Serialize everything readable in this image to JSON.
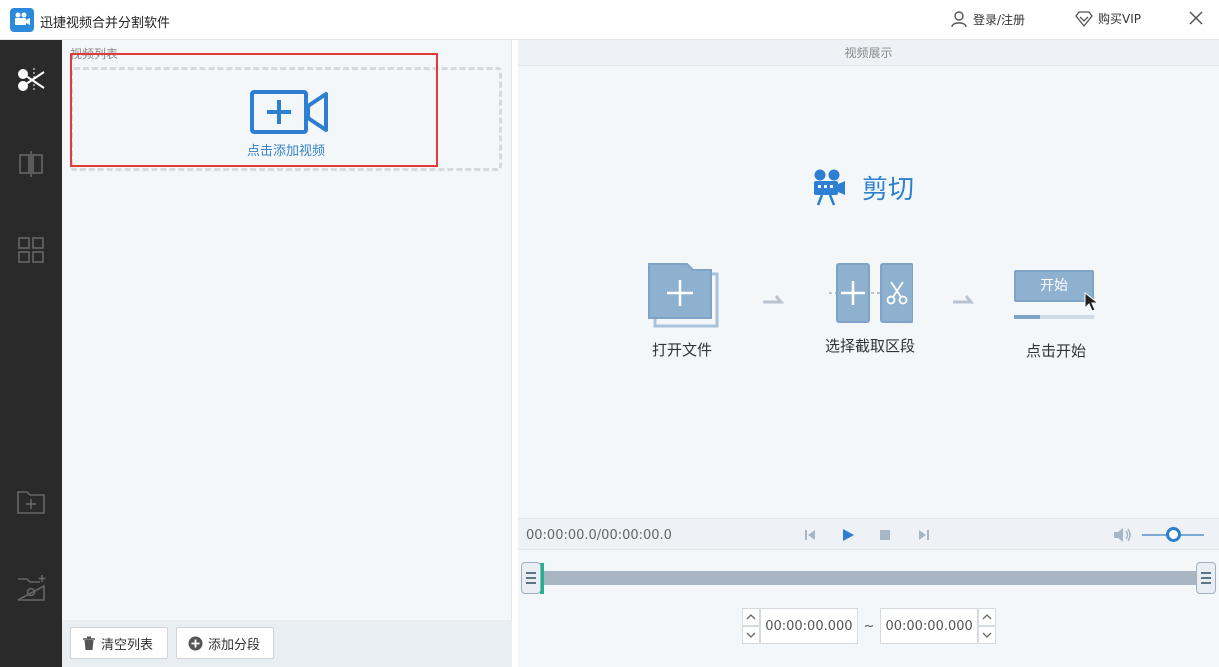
{
  "app": {
    "title": "迅捷视频合并分割软件"
  },
  "titlebar": {
    "login_label": "登录/注册",
    "vip_label": "购买VIP"
  },
  "sidebar": {
    "items": [
      {
        "icon": "scissors-icon",
        "active": true
      },
      {
        "icon": "split-columns-icon",
        "active": false
      },
      {
        "icon": "grid-icon",
        "active": false
      },
      {
        "icon": "folder-add-icon",
        "active": false
      },
      {
        "icon": "folder-settings-icon",
        "active": false
      }
    ]
  },
  "list_panel": {
    "header": "视频列表",
    "add_video_label": "点击添加视频",
    "clear_button": "清空列表",
    "add_segment_button": "添加分段"
  },
  "preview": {
    "header": "视频展示",
    "mode_title": "剪切",
    "steps": [
      {
        "label": "打开文件"
      },
      {
        "label": "选择截取区段"
      },
      {
        "label": "点击开始",
        "button_text": "开始"
      }
    ]
  },
  "player": {
    "time_readout": "00:00:00.0/00:00:00.0",
    "volume": 0.5
  },
  "trim": {
    "start_time": "00:00:00.000",
    "separator": "~",
    "end_time": "00:00:00.000"
  },
  "colors": {
    "accent": "#2c7fd1",
    "highlight": "#e23b3b",
    "trim_mark": "#1fb48e",
    "sidebar_bg": "#2a2a2a"
  }
}
